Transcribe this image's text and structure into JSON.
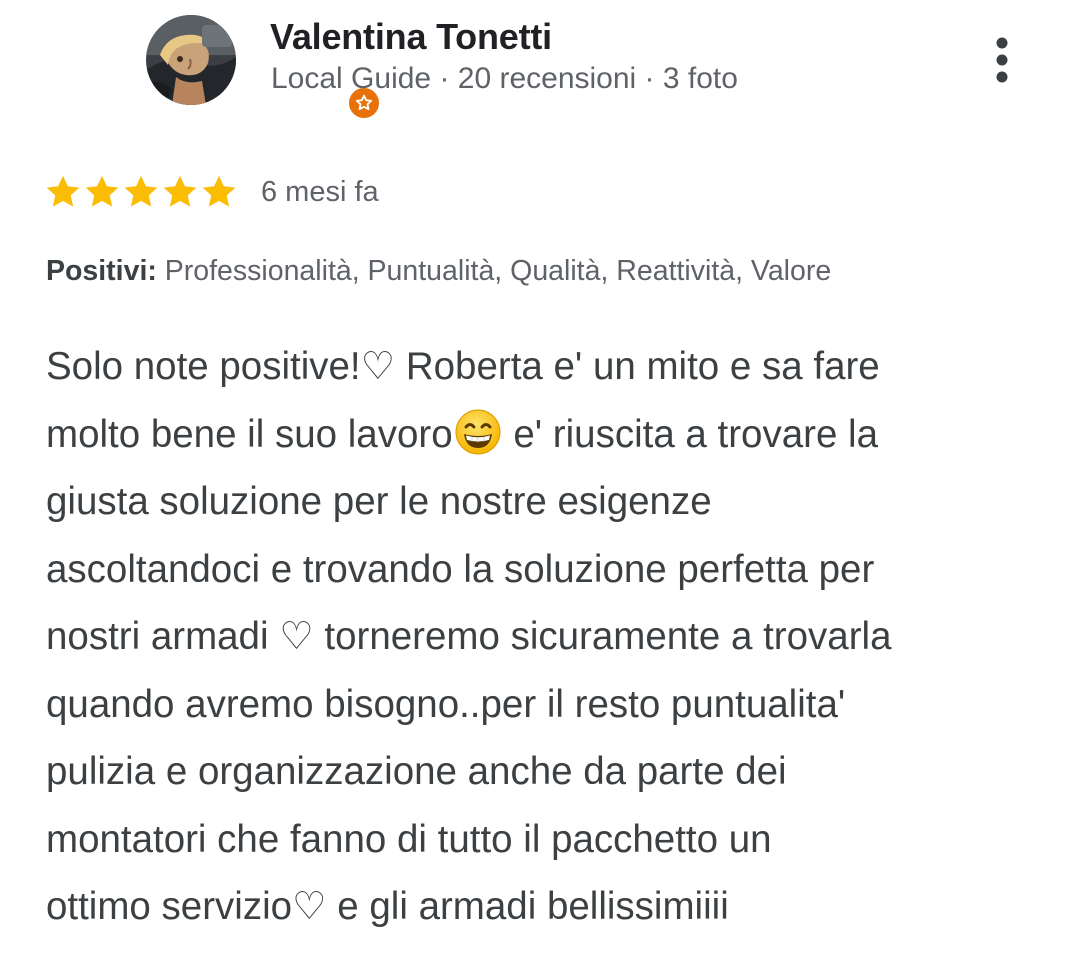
{
  "reviewer": {
    "name": "Valentina Tonetti",
    "meta": "Local Guide · 20 recensioni · 3 foto",
    "avatar_icon": "reviewer-photo",
    "badge_icon": "local-guide-star-icon",
    "badge_color": "#e8710a"
  },
  "menu": {
    "icon": "more-vert-icon"
  },
  "rating": {
    "stars": 5,
    "max_stars": 5,
    "star_color": "#fbbc04",
    "date": "6 mesi fa"
  },
  "highlights": {
    "label": "Positivi:",
    "values": " Professionalità, Puntualità, Qualità, Reattività, Valore"
  },
  "review": {
    "lines": [
      "Solo note positive!♡ Roberta e' un mito e sa fare",
      "molto bene il suo lavoro",
      " e' riuscita a trovare la",
      "giusta soluzione per le nostre esigenze",
      "ascoltandoci e trovando la soluzione perfetta per",
      "nostri armadi ♡ torneremo sicuramente a trovarla",
      "quando avremo bisogno..per il resto puntualita'",
      "pulizia e organizzazione anche da parte dei",
      "montatori che fanno di tutto il pacchetto un",
      "ottimo servizio♡ e gli armadi bellissimiiii"
    ],
    "emoji": "grinning-face-with-smiling-eyes-emoji"
  }
}
